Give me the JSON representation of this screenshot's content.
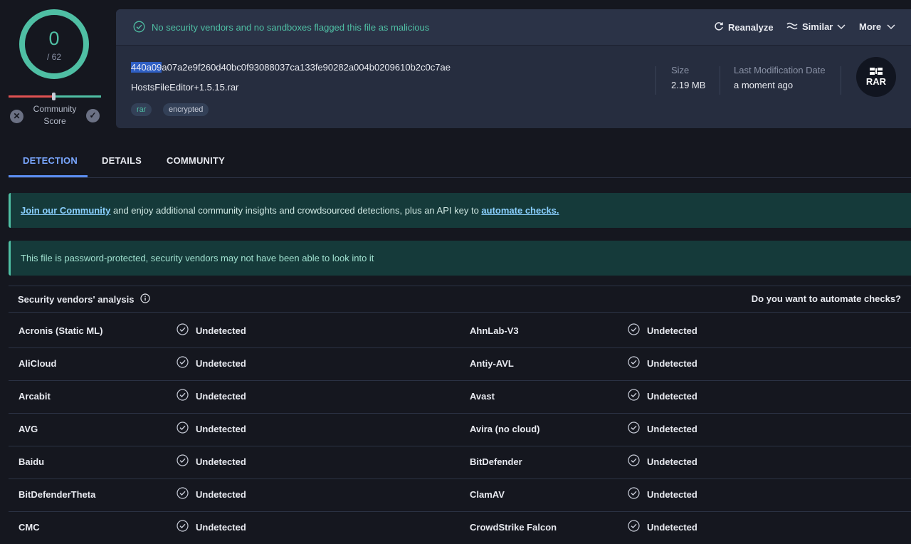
{
  "score": {
    "detections": "0",
    "total": "/ 62"
  },
  "community": {
    "label_line1": "Community",
    "label_line2": "Score"
  },
  "header": {
    "status": "No security vendors and no sandboxes flagged this file as malicious",
    "actions": {
      "reanalyze": "Reanalyze",
      "similar": "Similar",
      "more": "More"
    },
    "hash_selected": "440a09",
    "hash_rest": "a07a2e9f260d40bc0f93088037ca133fe90282a004b0209610b2c0c7ae",
    "filename": "HostsFileEditor+1.5.15.rar",
    "tags": [
      "rar",
      "encrypted"
    ],
    "size_label": "Size",
    "size_value": "2.19 MB",
    "lmd_label": "Last Modification Date",
    "lmd_value": "a moment ago",
    "file_type": "RAR"
  },
  "tabs": [
    "DETECTION",
    "DETAILS",
    "COMMUNITY"
  ],
  "banners": {
    "join_link": "Join our Community",
    "join_mid": " and enjoy additional community insights and crowdsourced detections, plus an API key to ",
    "join_link2": "automate checks.",
    "password_note": "This file is password-protected, security vendors may not have been able to look into it"
  },
  "table": {
    "title": "Security vendors' analysis",
    "right_link": "Do you want to automate checks?",
    "rows": [
      {
        "v1": "Acronis (Static ML)",
        "r1": "Undetected",
        "v2": "AhnLab-V3",
        "r2": "Undetected"
      },
      {
        "v1": "AliCloud",
        "r1": "Undetected",
        "v2": "Antiy-AVL",
        "r2": "Undetected"
      },
      {
        "v1": "Arcabit",
        "r1": "Undetected",
        "v2": "Avast",
        "r2": "Undetected"
      },
      {
        "v1": "AVG",
        "r1": "Undetected",
        "v2": "Avira (no cloud)",
        "r2": "Undetected"
      },
      {
        "v1": "Baidu",
        "r1": "Undetected",
        "v2": "BitDefender",
        "r2": "Undetected"
      },
      {
        "v1": "BitDefenderTheta",
        "r1": "Undetected",
        "v2": "ClamAV",
        "r2": "Undetected"
      },
      {
        "v1": "CMC",
        "r1": "Undetected",
        "v2": "CrowdStrike Falcon",
        "r2": "Undetected"
      }
    ]
  },
  "colors": {
    "accent": "#4fbfa4",
    "link": "#7aa7ff",
    "danger": "#e05252"
  },
  "icons": [
    "check-circle-icon",
    "reanalyze-icon",
    "similar-icon",
    "chevron-down-icon",
    "info-icon",
    "rar-file-icon",
    "close-icon"
  ]
}
